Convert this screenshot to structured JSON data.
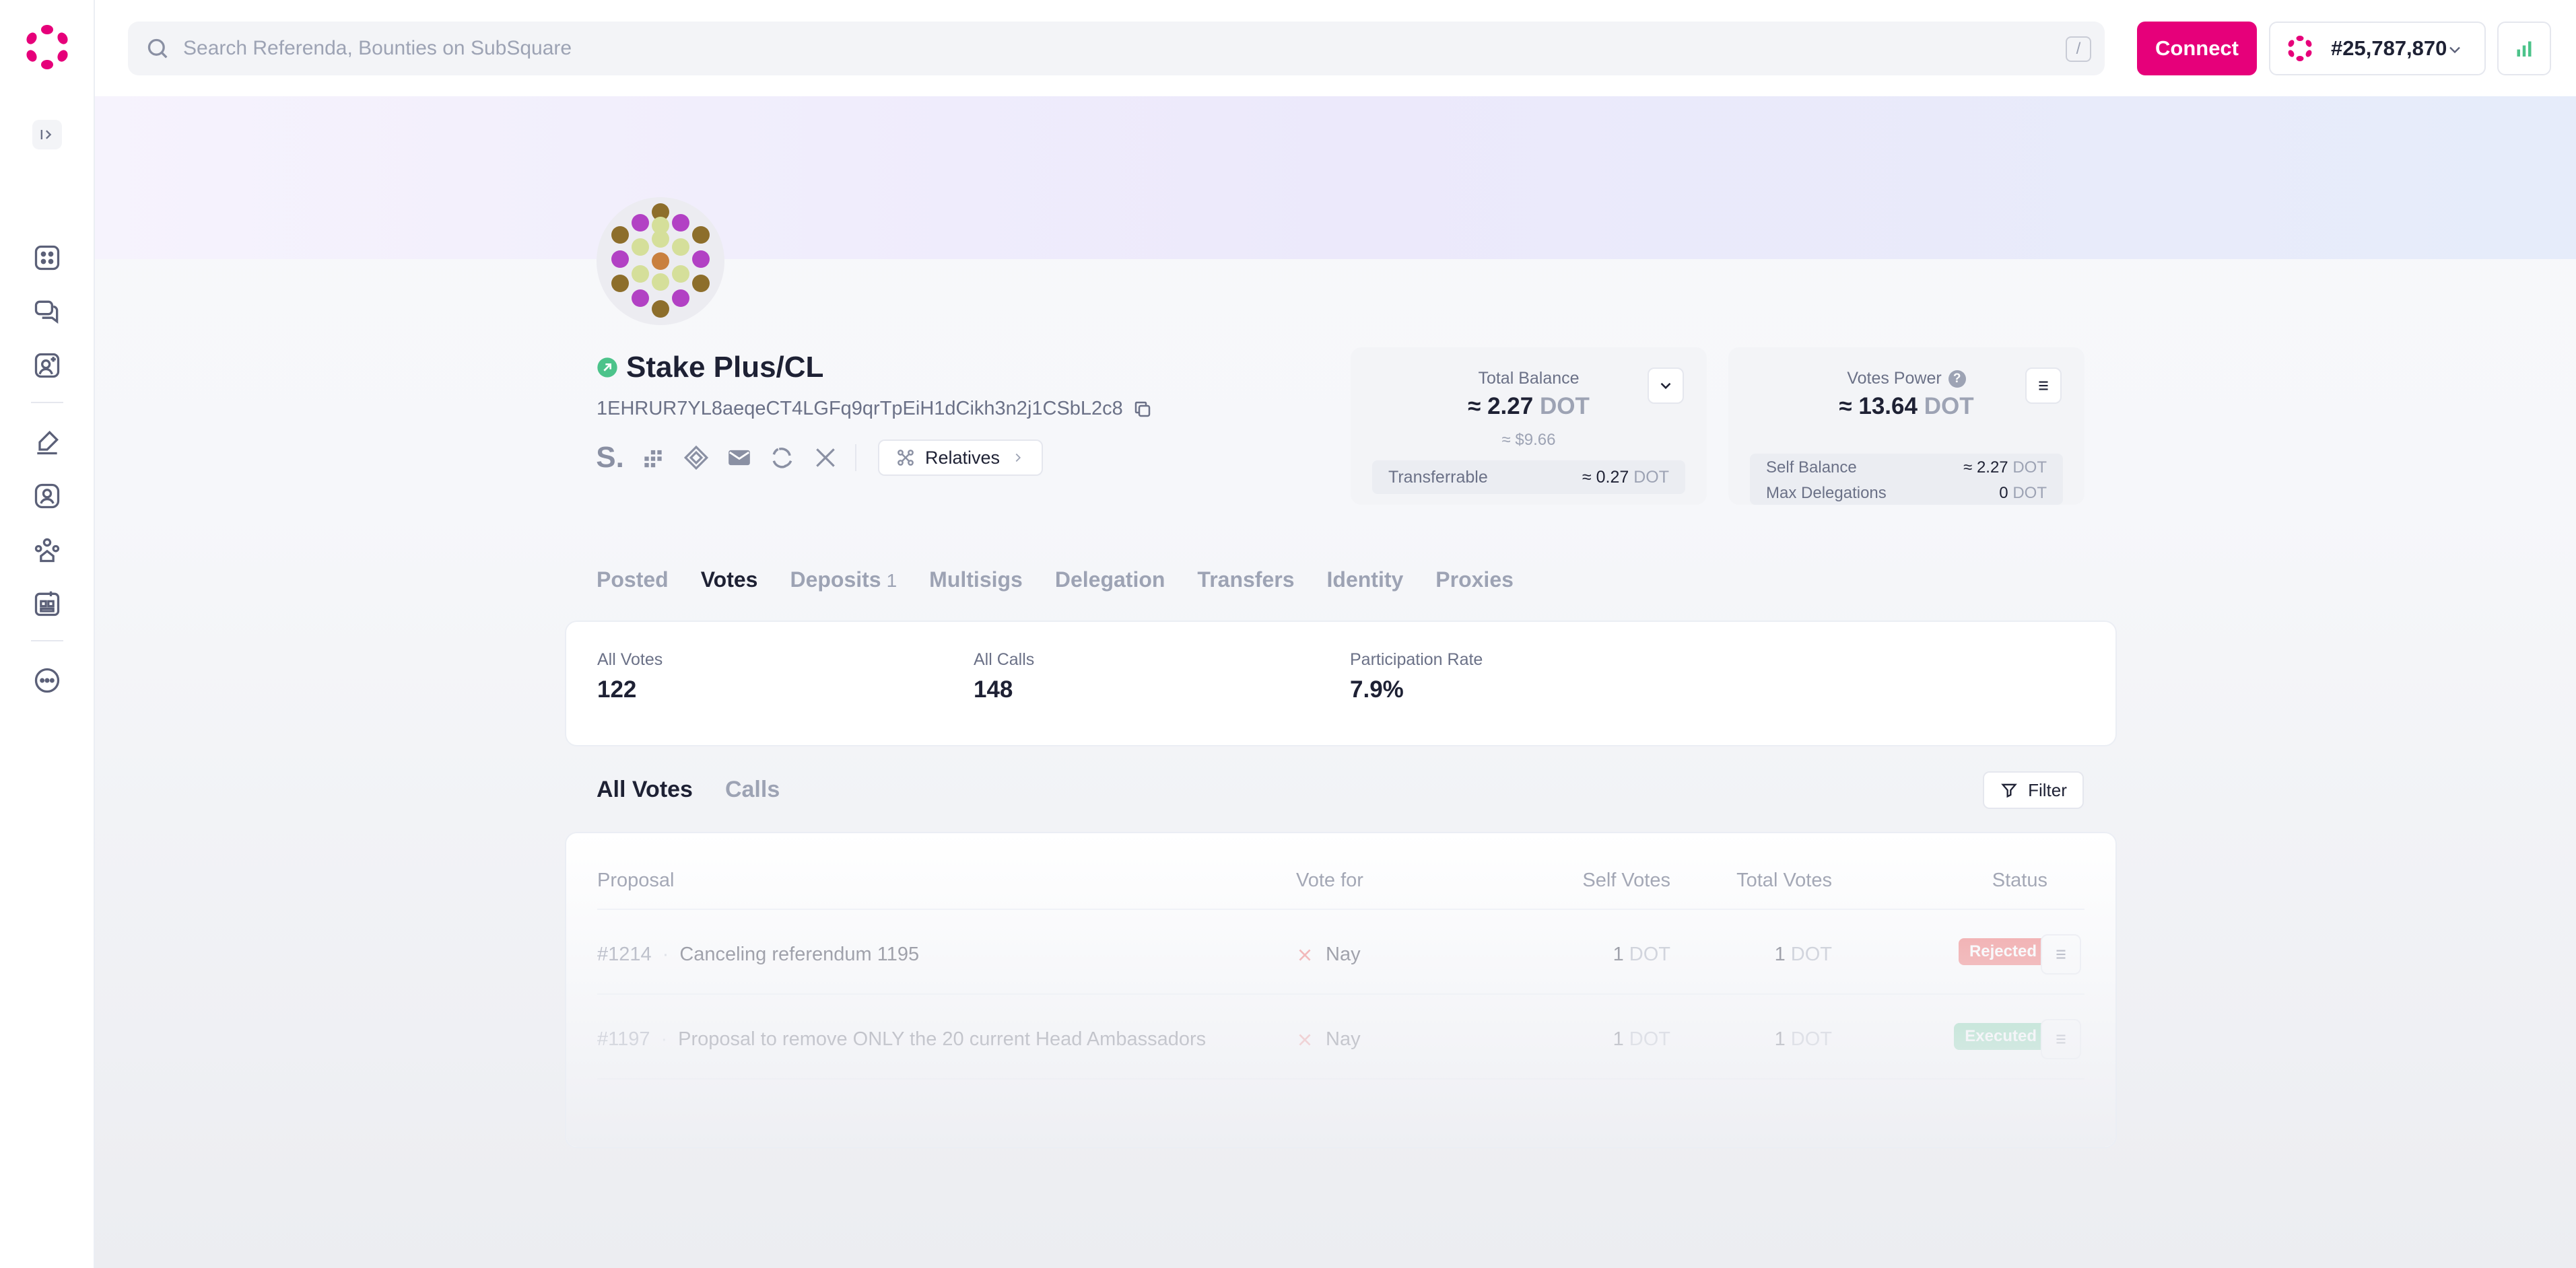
{
  "header": {
    "search_placeholder": "Search Referenda, Bounties on SubSquare",
    "search_shortcut": "/",
    "connect_label": "Connect",
    "block_number": "#25,787,870"
  },
  "colors": {
    "accent": "#e6007a",
    "rejected": "#f05d5d",
    "executed": "#4cc38a",
    "verified": "#4cc38a"
  },
  "sidebar": {
    "icons": [
      "polkadot-logo-icon",
      "sidebar-toggle-icon",
      "apps-icon",
      "discussions-icon",
      "profile-icon",
      "governance-icon",
      "fellowship-icon",
      "ambassador-icon",
      "treasury-icon",
      "more-icon"
    ]
  },
  "profile": {
    "name": "Stake Plus/CL",
    "address": "1EHRUR7YL8aeqeCT4LGFq9qrTpEiH1dCikh3n2j1CSbL2c8",
    "social_s": "S.",
    "relatives_label": "Relatives"
  },
  "balance": {
    "title": "Total Balance",
    "approx": "≈",
    "value": "2.27",
    "unit": "DOT",
    "usd": "≈ $9.66",
    "transferrable_label": "Transferrable",
    "transferrable_approx": "≈",
    "transferrable_value": "0.27",
    "transferrable_unit": "DOT"
  },
  "votes_power": {
    "title": "Votes Power",
    "help": "?",
    "approx": "≈",
    "value": "13.64",
    "unit": "DOT",
    "self_balance_label": "Self Balance",
    "self_balance_approx": "≈",
    "self_balance_value": "2.27",
    "self_balance_unit": "DOT",
    "max_delegations_label": "Max Delegations",
    "max_delegations_value": "0",
    "max_delegations_unit": "DOT"
  },
  "tabs": [
    {
      "label": "Posted",
      "count": ""
    },
    {
      "label": "Votes",
      "count": ""
    },
    {
      "label": "Deposits",
      "count": "1"
    },
    {
      "label": "Multisigs",
      "count": ""
    },
    {
      "label": "Delegation",
      "count": ""
    },
    {
      "label": "Transfers",
      "count": ""
    },
    {
      "label": "Identity",
      "count": ""
    },
    {
      "label": "Proxies",
      "count": ""
    }
  ],
  "active_tab": "Votes",
  "stats": [
    {
      "label": "All Votes",
      "value": "122"
    },
    {
      "label": "All Calls",
      "value": "148"
    },
    {
      "label": "Participation Rate",
      "value": "7.9%"
    }
  ],
  "subtabs": [
    "All Votes",
    "Calls"
  ],
  "filter_label": "Filter",
  "table": {
    "headers": {
      "proposal": "Proposal",
      "vote_for": "Vote for",
      "self_votes": "Self Votes",
      "total_votes": "Total Votes",
      "status": "Status"
    },
    "rows": [
      {
        "id": "#1214",
        "sep": "·",
        "title": "Canceling referendum 1195",
        "vote": "Nay",
        "self_value": "1",
        "self_unit": "DOT",
        "total_value": "1",
        "total_unit": "DOT",
        "status": "Rejected"
      },
      {
        "id": "#1197",
        "sep": "·",
        "title": "Proposal to remove ONLY the 20 current Head Ambassadors",
        "vote": "Nay",
        "self_value": "1",
        "self_unit": "DOT",
        "total_value": "1",
        "total_unit": "DOT",
        "status": "Executed"
      }
    ]
  }
}
